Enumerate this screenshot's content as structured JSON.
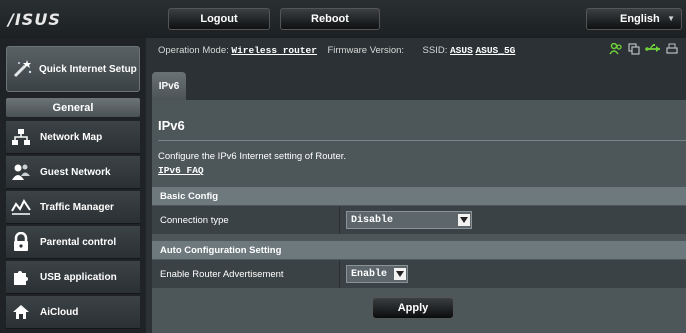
{
  "header": {
    "logo": "/ISUS",
    "logout_label": "Logout",
    "reboot_label": "Reboot",
    "language_label": "English"
  },
  "sidebar": {
    "quick_setup_label": "Quick Internet Setup",
    "general_label": "General",
    "items": [
      {
        "label": "Network Map",
        "icon": "network-map-icon"
      },
      {
        "label": "Guest Network",
        "icon": "guest-network-icon"
      },
      {
        "label": "Traffic Manager",
        "icon": "traffic-manager-icon"
      },
      {
        "label": "Parental control",
        "icon": "lock-icon"
      },
      {
        "label": "USB application",
        "icon": "puzzle-icon"
      },
      {
        "label": "AiCloud",
        "icon": "cloud-icon"
      }
    ]
  },
  "status": {
    "op_mode_label": "Operation Mode:",
    "op_mode_value": "Wireless router",
    "firmware_label": "Firmware Version:",
    "ssid_label": "SSID:",
    "ssid_1": "ASUS",
    "ssid_2": "ASUS_5G"
  },
  "main": {
    "tab_label": "IPv6",
    "title": "IPv6",
    "description": "Configure the IPv6 Internet setting of Router.",
    "faq_link": "IPv6 FAQ",
    "basic_config_header": "Basic Config",
    "connection_type_label": "Connection type",
    "connection_type_value": "Disable",
    "auto_config_header": "Auto Configuration Setting",
    "router_adv_label": "Enable Router Advertisement",
    "router_adv_value": "Enable",
    "apply_label": "Apply"
  },
  "colors": {
    "accent_green": "#6fd13a",
    "panel_bg": "#4d5659",
    "section_header": "#6e797e"
  }
}
